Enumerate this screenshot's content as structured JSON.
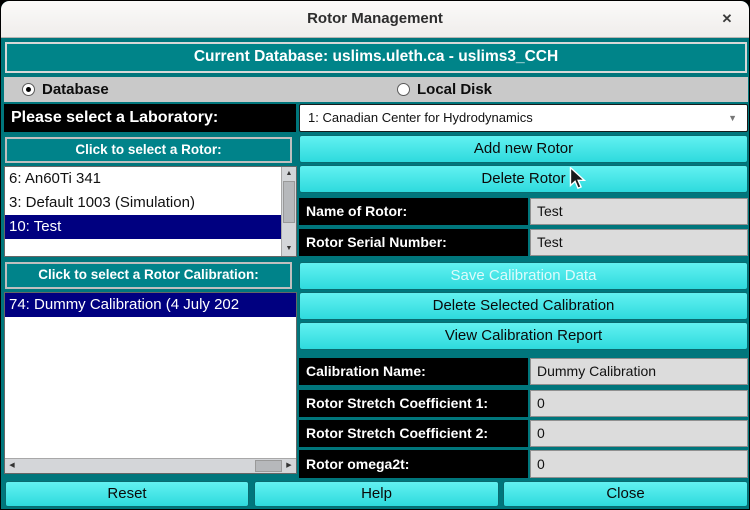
{
  "window": {
    "title": "Rotor Management"
  },
  "icons": {
    "close": "✕",
    "dropdown_arrow": "▼",
    "scroll_up": "▲",
    "scroll_down": "▼",
    "scroll_left": "◀",
    "scroll_right": "▶"
  },
  "banner": {
    "text": "Current Database: uslims.uleth.ca - uslims3_CCH"
  },
  "source_toggle": {
    "options": [
      {
        "label": "Database",
        "selected": true
      },
      {
        "label": "Local Disk",
        "selected": false
      }
    ]
  },
  "laboratory": {
    "label": "Please select a Laboratory:",
    "selected_option": "1: Canadian Center for Hydrodynamics"
  },
  "rotor": {
    "list_header": "Click to select a Rotor:",
    "items": [
      {
        "text": "6: An60Ti 341",
        "selected": false
      },
      {
        "text": "3: Default 1003 (Simulation)",
        "selected": false
      },
      {
        "text": "10: Test",
        "selected": true
      }
    ],
    "add_button": "Add new Rotor",
    "delete_button": "Delete Rotor",
    "name_label": "Name of Rotor:",
    "name_value": "Test",
    "serial_label": "Rotor Serial Number:",
    "serial_value": "Test"
  },
  "calibration": {
    "list_header": "Click to select a Rotor Calibration:",
    "items": [
      {
        "text": "74: Dummy Calibration (4 July 202",
        "selected": true
      }
    ],
    "save_button": "Save Calibration Data",
    "save_enabled": false,
    "delete_button": "Delete Selected Calibration",
    "report_button": "View Calibration Report",
    "fields": [
      {
        "label": "Calibration Name:",
        "value": "Dummy Calibration"
      },
      {
        "label": "Rotor Stretch Coefficient 1:",
        "value": "0"
      },
      {
        "label": "Rotor Stretch Coefficient 2:",
        "value": "0"
      },
      {
        "label": "Rotor omega2t:",
        "value": "0"
      }
    ]
  },
  "footer": {
    "reset_button": "Reset",
    "help_button": "Help",
    "close_button": "Close"
  },
  "colors": {
    "background_teal": "#00767c",
    "banner_teal": "#008489",
    "button_cyan_top": "#62f1f1",
    "button_cyan_bottom": "#2edadd",
    "selection_navy": "#000080",
    "field_gray": "#dcdcdc",
    "radio_row_gray": "#c9c9c9"
  }
}
